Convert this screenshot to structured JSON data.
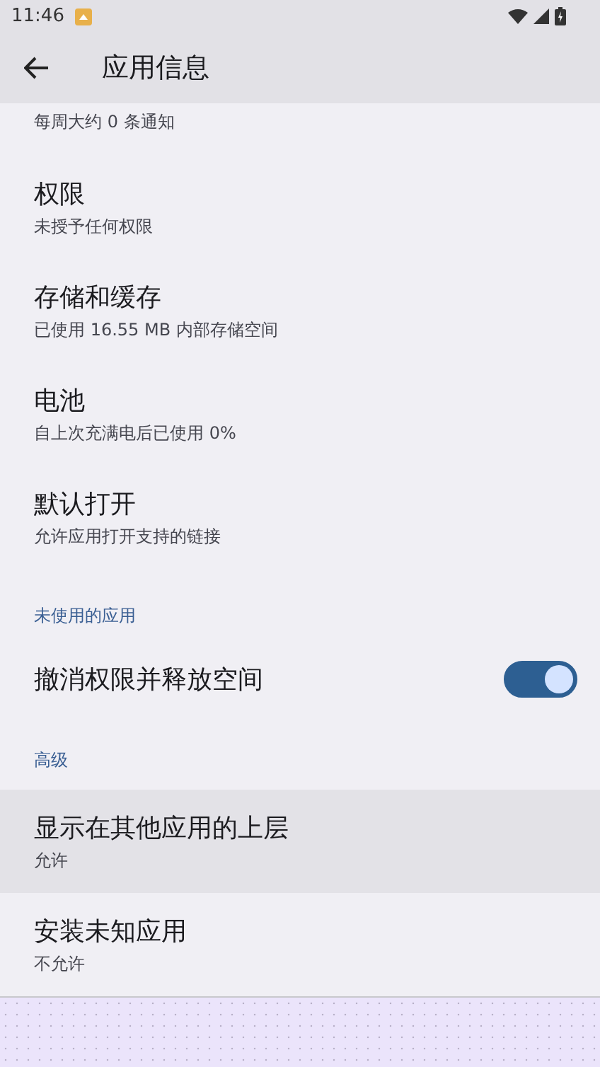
{
  "status_bar": {
    "time": "11:46"
  },
  "app_bar": {
    "title": "应用信息"
  },
  "items": [
    {
      "kind": "partial",
      "subtitle": "每周大约 0 条通知",
      "selected": false
    },
    {
      "kind": "item",
      "title": "权限",
      "subtitle": "未授予任何权限",
      "selected": false
    },
    {
      "kind": "item",
      "title": "存储和缓存",
      "subtitle": "已使用 16.55 MB 内部存储空间",
      "selected": false
    },
    {
      "kind": "item",
      "title": "电池",
      "subtitle": "自上次充满电后已使用 0%",
      "selected": false
    },
    {
      "kind": "item",
      "title": "默认打开",
      "subtitle": "允许应用打开支持的链接",
      "selected": false
    },
    {
      "kind": "header",
      "title": "未使用的应用"
    },
    {
      "kind": "switch",
      "title": "撤消权限并释放空间",
      "on": true
    },
    {
      "kind": "header",
      "title": "高级"
    },
    {
      "kind": "item",
      "title": "显示在其他应用的上层",
      "subtitle": "允许",
      "selected": true
    },
    {
      "kind": "item",
      "title": "安装未知应用",
      "subtitle": "不允许",
      "selected": false
    }
  ]
}
